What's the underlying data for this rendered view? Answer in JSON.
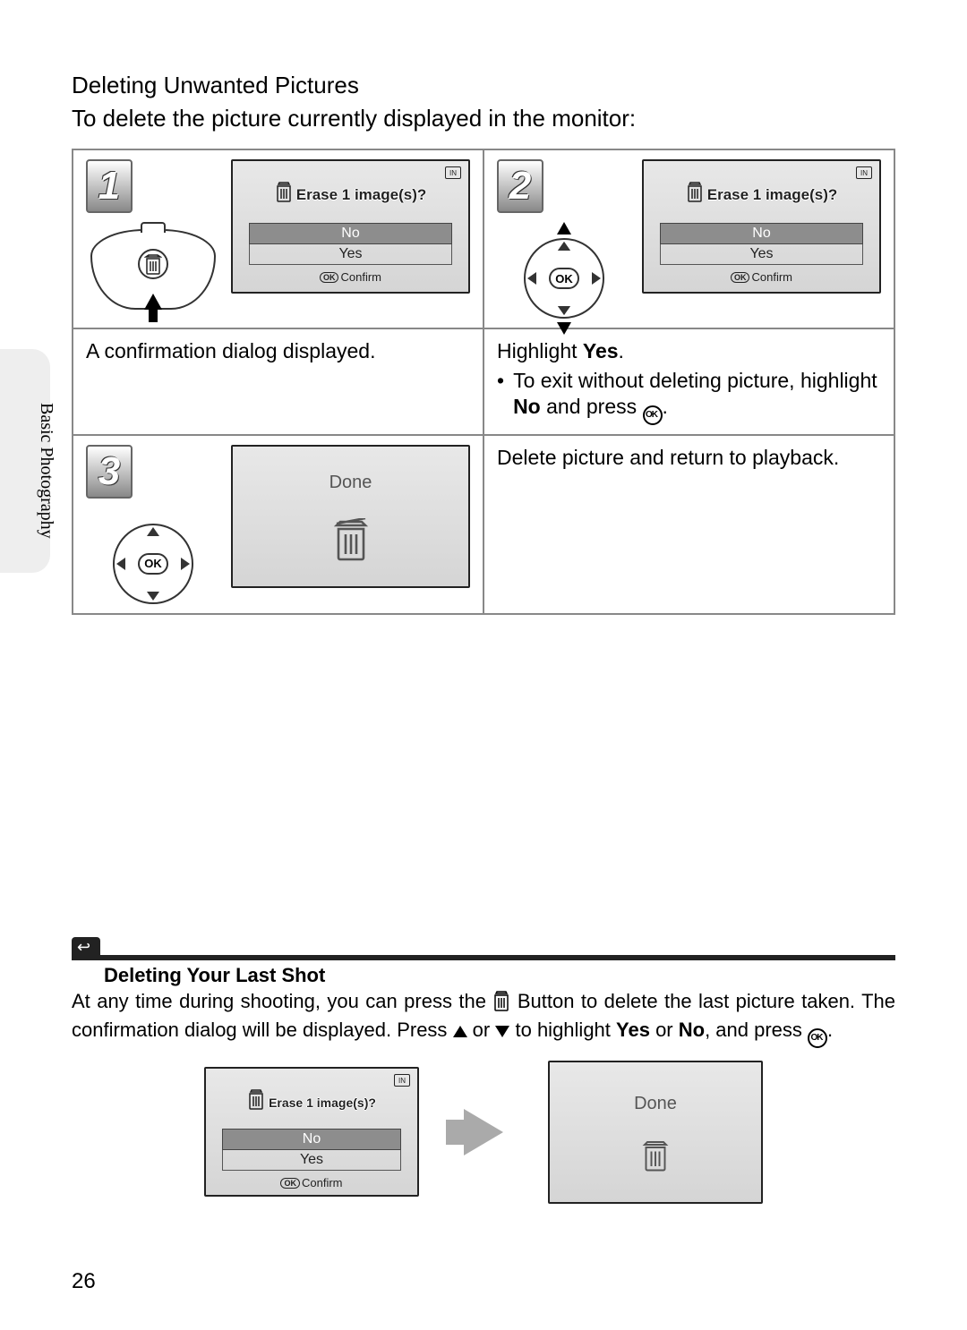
{
  "page_number": "26",
  "side_tab": "Basic Photography",
  "title": "Deleting Unwanted Pictures",
  "intro": "To delete the picture currently displayed in the monitor:",
  "steps": [
    {
      "num": "1",
      "lcd": {
        "prompt": "Erase 1 image(s)?",
        "opt_no": "No",
        "opt_yes": "Yes",
        "selected": "No",
        "confirm": "Confirm",
        "badge": "IN"
      },
      "desc": "A confirmation dialog displayed."
    },
    {
      "num": "2",
      "lcd": {
        "prompt": "Erase 1 image(s)?",
        "opt_no": "No",
        "opt_yes": "Yes",
        "selected": "No",
        "confirm": "Confirm",
        "badge": "IN"
      },
      "desc_lead": "Highlight ",
      "desc_strong": "Yes",
      "desc_trail": ".",
      "bullet_a": "To exit without deleting picture, highlight ",
      "bullet_strong": "No",
      "bullet_b": " and press ",
      "bullet_c": "."
    },
    {
      "num": "3",
      "lcd_done": "Done",
      "desc": "Delete picture and return to playback."
    }
  ],
  "note": {
    "title": "Deleting Your Last Shot",
    "body_a": "At any time during shooting, you can press the ",
    "body_b": " Button to delete the last picture taken. The confirmation dialog will be displayed. Press ",
    "body_c": " or ",
    "body_d": " to highlight ",
    "yes": "Yes",
    "body_e": " or ",
    "no": "No",
    "body_f": ", and press ",
    "body_g": ".",
    "lcd": {
      "prompt": "Erase 1 image(s)?",
      "opt_no": "No",
      "opt_yes": "Yes",
      "confirm": "Confirm",
      "badge": "IN"
    },
    "done": "Done"
  }
}
